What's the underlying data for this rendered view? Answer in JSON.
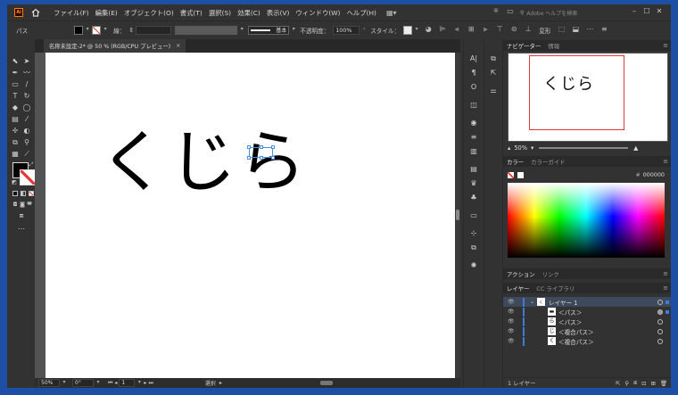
{
  "app": {
    "logo": "Ai"
  },
  "menu": [
    "ファイル(F)",
    "編集(E)",
    "オブジェクト(O)",
    "書式(T)",
    "選択(S)",
    "効果(C)",
    "表示(V)",
    "ウィンドウ(W)",
    "ヘルプ(H)"
  ],
  "search": {
    "placeholder": "Adobe ヘルプを検索"
  },
  "window": {
    "minimize": "–",
    "maximize": "☐",
    "close": "✕"
  },
  "control": {
    "object_type": "パス",
    "stroke_label": "線：",
    "stroke_weight": "",
    "brush": "基本",
    "opacity_label": "不透明度：",
    "opacity_value": "100%",
    "style_label": "スタイル：",
    "transform_label": "変形"
  },
  "document": {
    "tab_title": "名称未設定-2* @ 50 % (RGB/CPU プレビュー)",
    "close": "×"
  },
  "canvas": {
    "text": "くじら"
  },
  "status": {
    "zoom": "50%",
    "rotation": "0°",
    "page": "1",
    "tool": "選択"
  },
  "navigator": {
    "tabs": [
      "ナビゲーター",
      "情報"
    ],
    "zoom": "50%",
    "preview_text": "くじら"
  },
  "color": {
    "tabs": [
      "カラー",
      "カラーガイド"
    ],
    "hex_prefix": "#",
    "hex": "000000"
  },
  "actions": {
    "tabs": [
      "アクション",
      "リンク"
    ]
  },
  "layers": {
    "tabs": [
      "レイヤー",
      "CC ライブラリ"
    ],
    "layer_name": "レイヤー 1",
    "items": [
      "＜パス＞",
      "＜パス＞",
      "＜複合パス＞",
      "＜複合パス＞"
    ],
    "count": "1 レイヤー"
  },
  "colors": {
    "accent": "#3d7bd9",
    "artboard": "#ffffff",
    "workspace": "#535353",
    "ui": "#323232"
  }
}
